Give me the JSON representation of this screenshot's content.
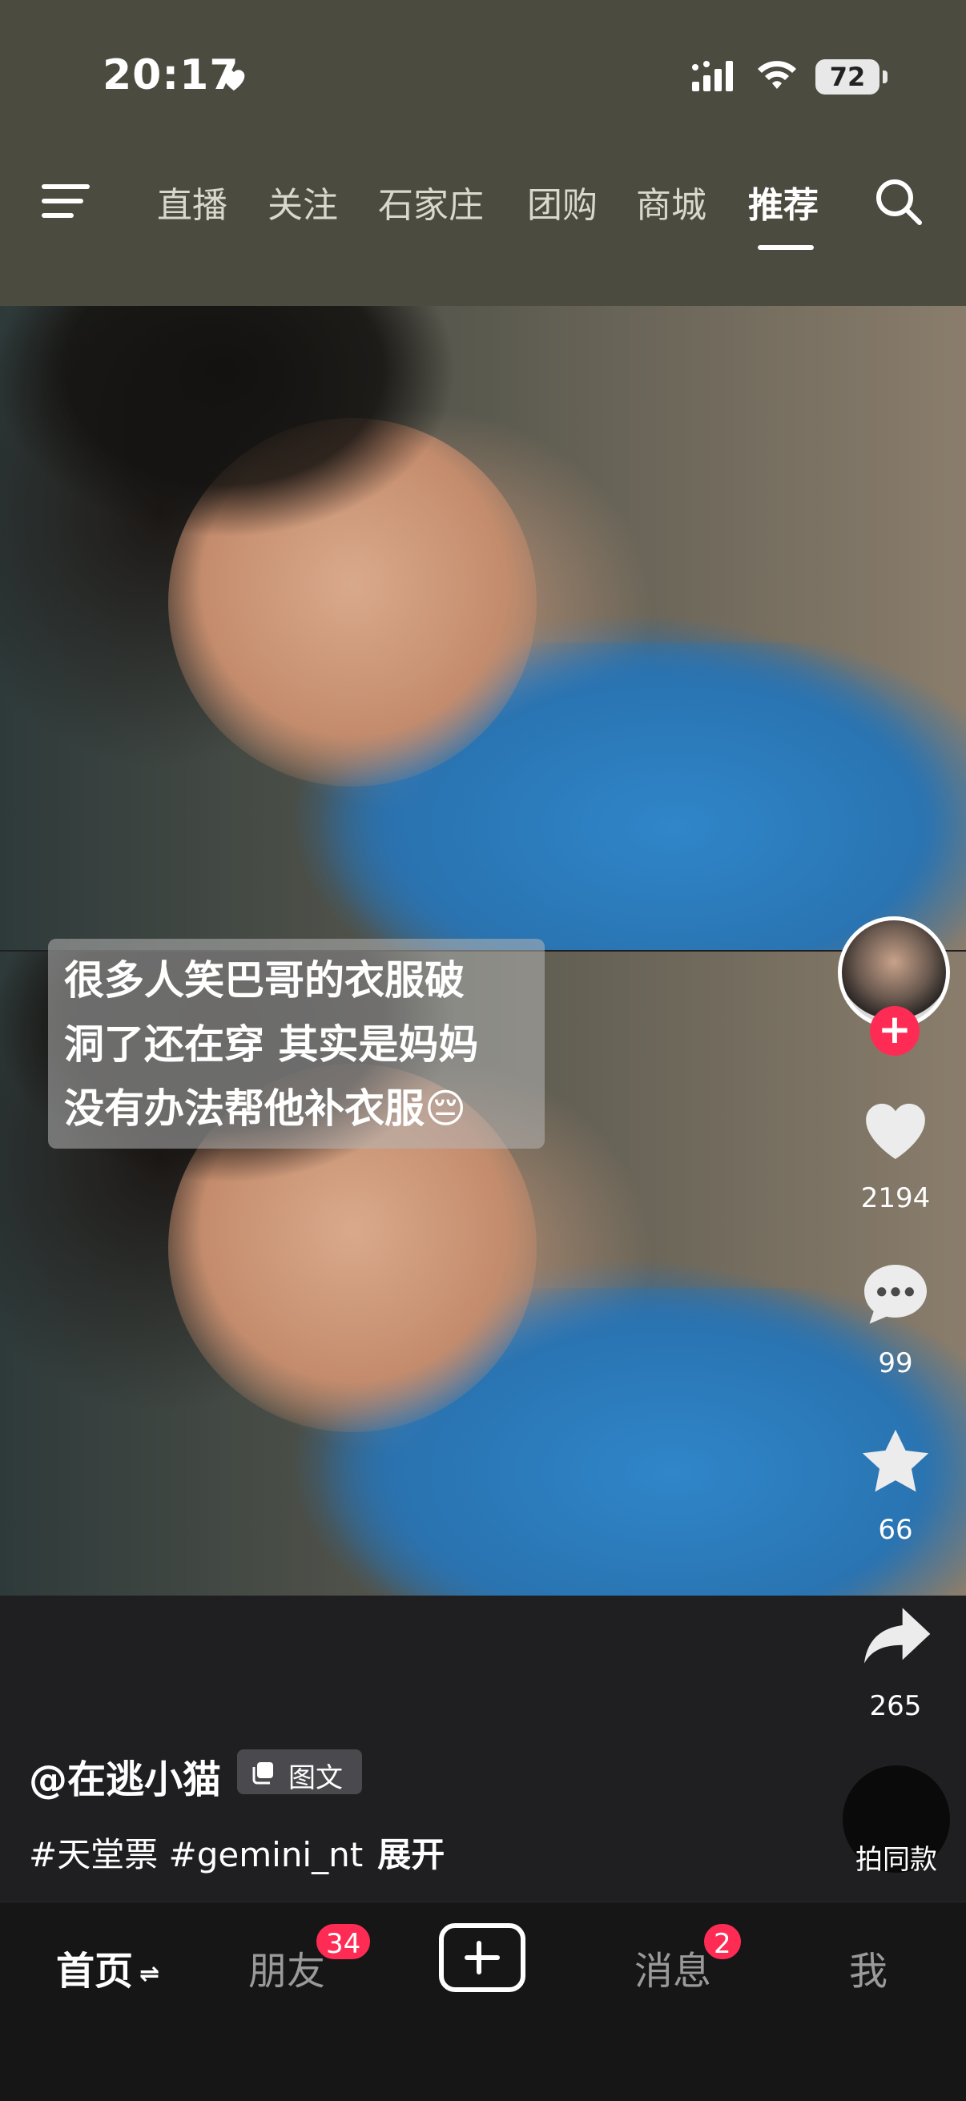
{
  "status_bar": {
    "time": "20:17",
    "battery": "72"
  },
  "top_tabs": [
    "直播",
    "关注",
    "石家庄",
    "团购",
    "商城",
    "推荐"
  ],
  "active_tab": "推荐",
  "caption": {
    "lines": [
      "很多人笑巴哥的衣服破",
      "洞了还在穿 其实是妈妈",
      "没有办法帮他补衣服😔"
    ]
  },
  "actions": {
    "likes": "2194",
    "comments": "99",
    "favorites": "66",
    "shares": "265",
    "remix_label": "拍同款"
  },
  "post": {
    "author": "@在逃小猫",
    "type_badge": "图文",
    "hashtags": "#天堂票 #gemini_nt",
    "expand": "展开"
  },
  "bottom_nav": {
    "home": "首页",
    "friends": "朋友",
    "friends_badge": "34",
    "messages": "消息",
    "messages_badge": "2",
    "me": "我"
  },
  "colors": {
    "accent": "#fe2c55",
    "top_bg": "#4b4b40",
    "nav_bg": "#161616"
  },
  "icons": [
    "heart-icon",
    "signal-icon",
    "wifi-icon",
    "battery-icon",
    "menu-icon",
    "search-icon",
    "like-icon",
    "comment-icon",
    "favorite-icon",
    "share-icon",
    "create-icon",
    "images-icon"
  ]
}
